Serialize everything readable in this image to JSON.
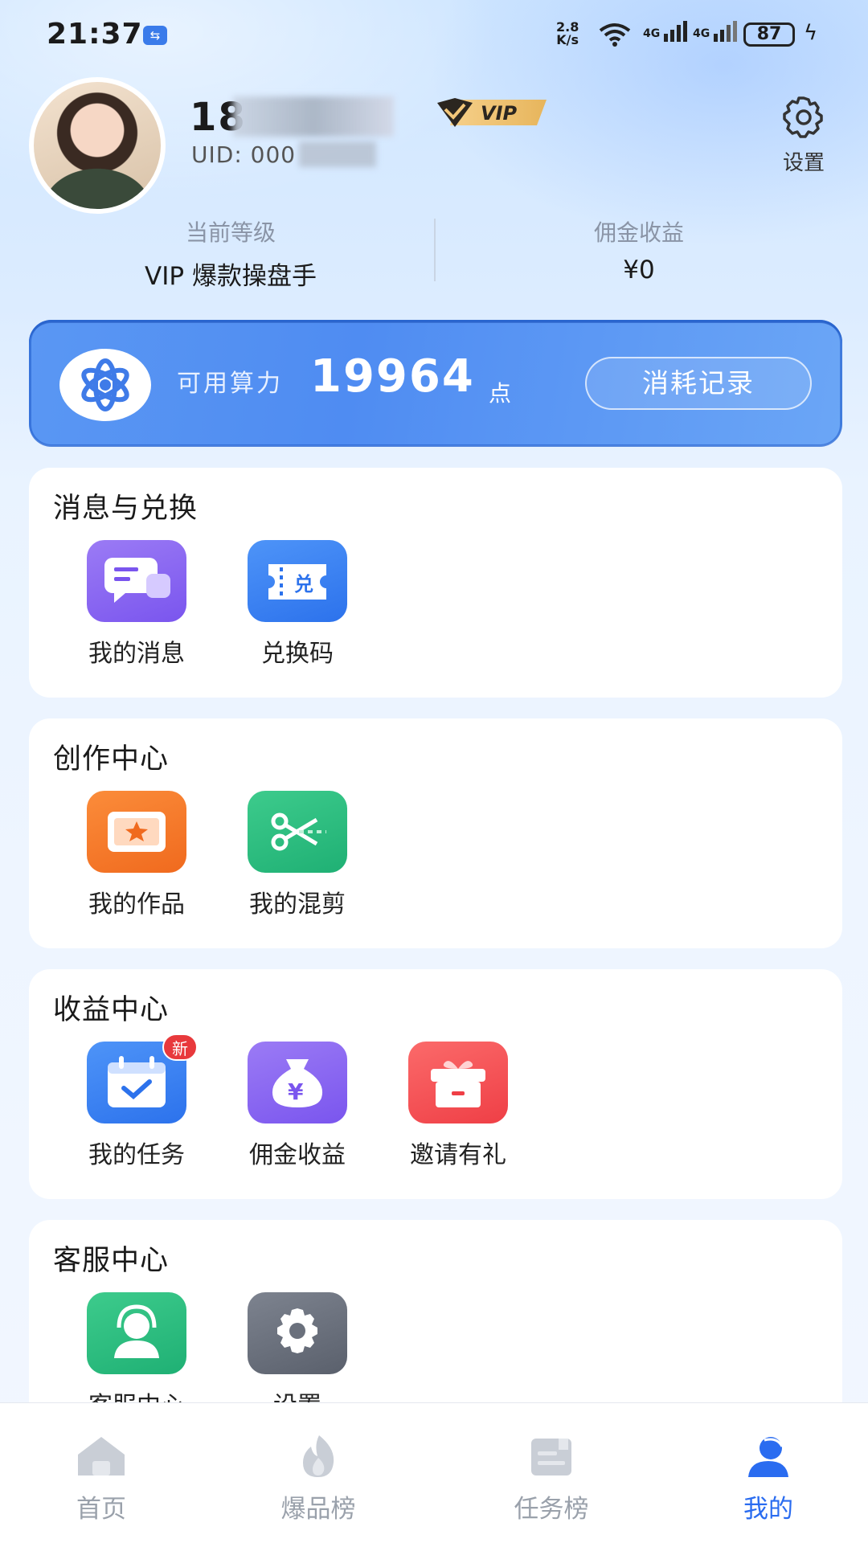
{
  "status_bar": {
    "time": "21:37",
    "net_speed": "2.8",
    "net_unit": "K/s",
    "sig1": "4G",
    "sig2": "4G",
    "battery": "87"
  },
  "profile": {
    "name": "18",
    "vip_badge": "VIP",
    "uid": "UID: 000",
    "settings_label": "设置"
  },
  "stats": {
    "level_label": "当前等级",
    "level_value": "VIP 爆款操盘手",
    "commission_label": "佣金收益",
    "commission_value": "¥0"
  },
  "compute": {
    "label": "可用算力",
    "value": "19964",
    "unit": "点",
    "button": "消耗记录"
  },
  "sections": [
    {
      "title": "消息与兑换",
      "items": [
        {
          "label": "我的消息",
          "icon": "message-icon"
        },
        {
          "label": "兑换码",
          "icon": "redeem-code-icon",
          "icon_text": "兑"
        }
      ]
    },
    {
      "title": "创作中心",
      "items": [
        {
          "label": "我的作品",
          "icon": "works-icon"
        },
        {
          "label": "我的混剪",
          "icon": "scissors-icon"
        }
      ]
    },
    {
      "title": "收益中心",
      "items": [
        {
          "label": "我的任务",
          "icon": "task-calendar-icon",
          "badge": "新"
        },
        {
          "label": "佣金收益",
          "icon": "money-bag-icon",
          "icon_text": "¥"
        },
        {
          "label": "邀请有礼",
          "icon": "gift-icon"
        }
      ]
    },
    {
      "title": "客服中心",
      "items": [
        {
          "label": "客服中心",
          "icon": "customer-service-icon"
        },
        {
          "label": "设置",
          "icon": "settings-gear-icon"
        }
      ]
    }
  ],
  "bottom_nav": [
    {
      "label": "首页",
      "icon": "home-icon"
    },
    {
      "label": "爆品榜",
      "icon": "fire-icon"
    },
    {
      "label": "任务榜",
      "icon": "task-board-icon"
    },
    {
      "label": "我的",
      "icon": "user-icon",
      "active": true
    }
  ],
  "colors": {
    "accent": "#2a6cf0",
    "banner": "#4f8cf2",
    "badge": "#e8393c"
  }
}
